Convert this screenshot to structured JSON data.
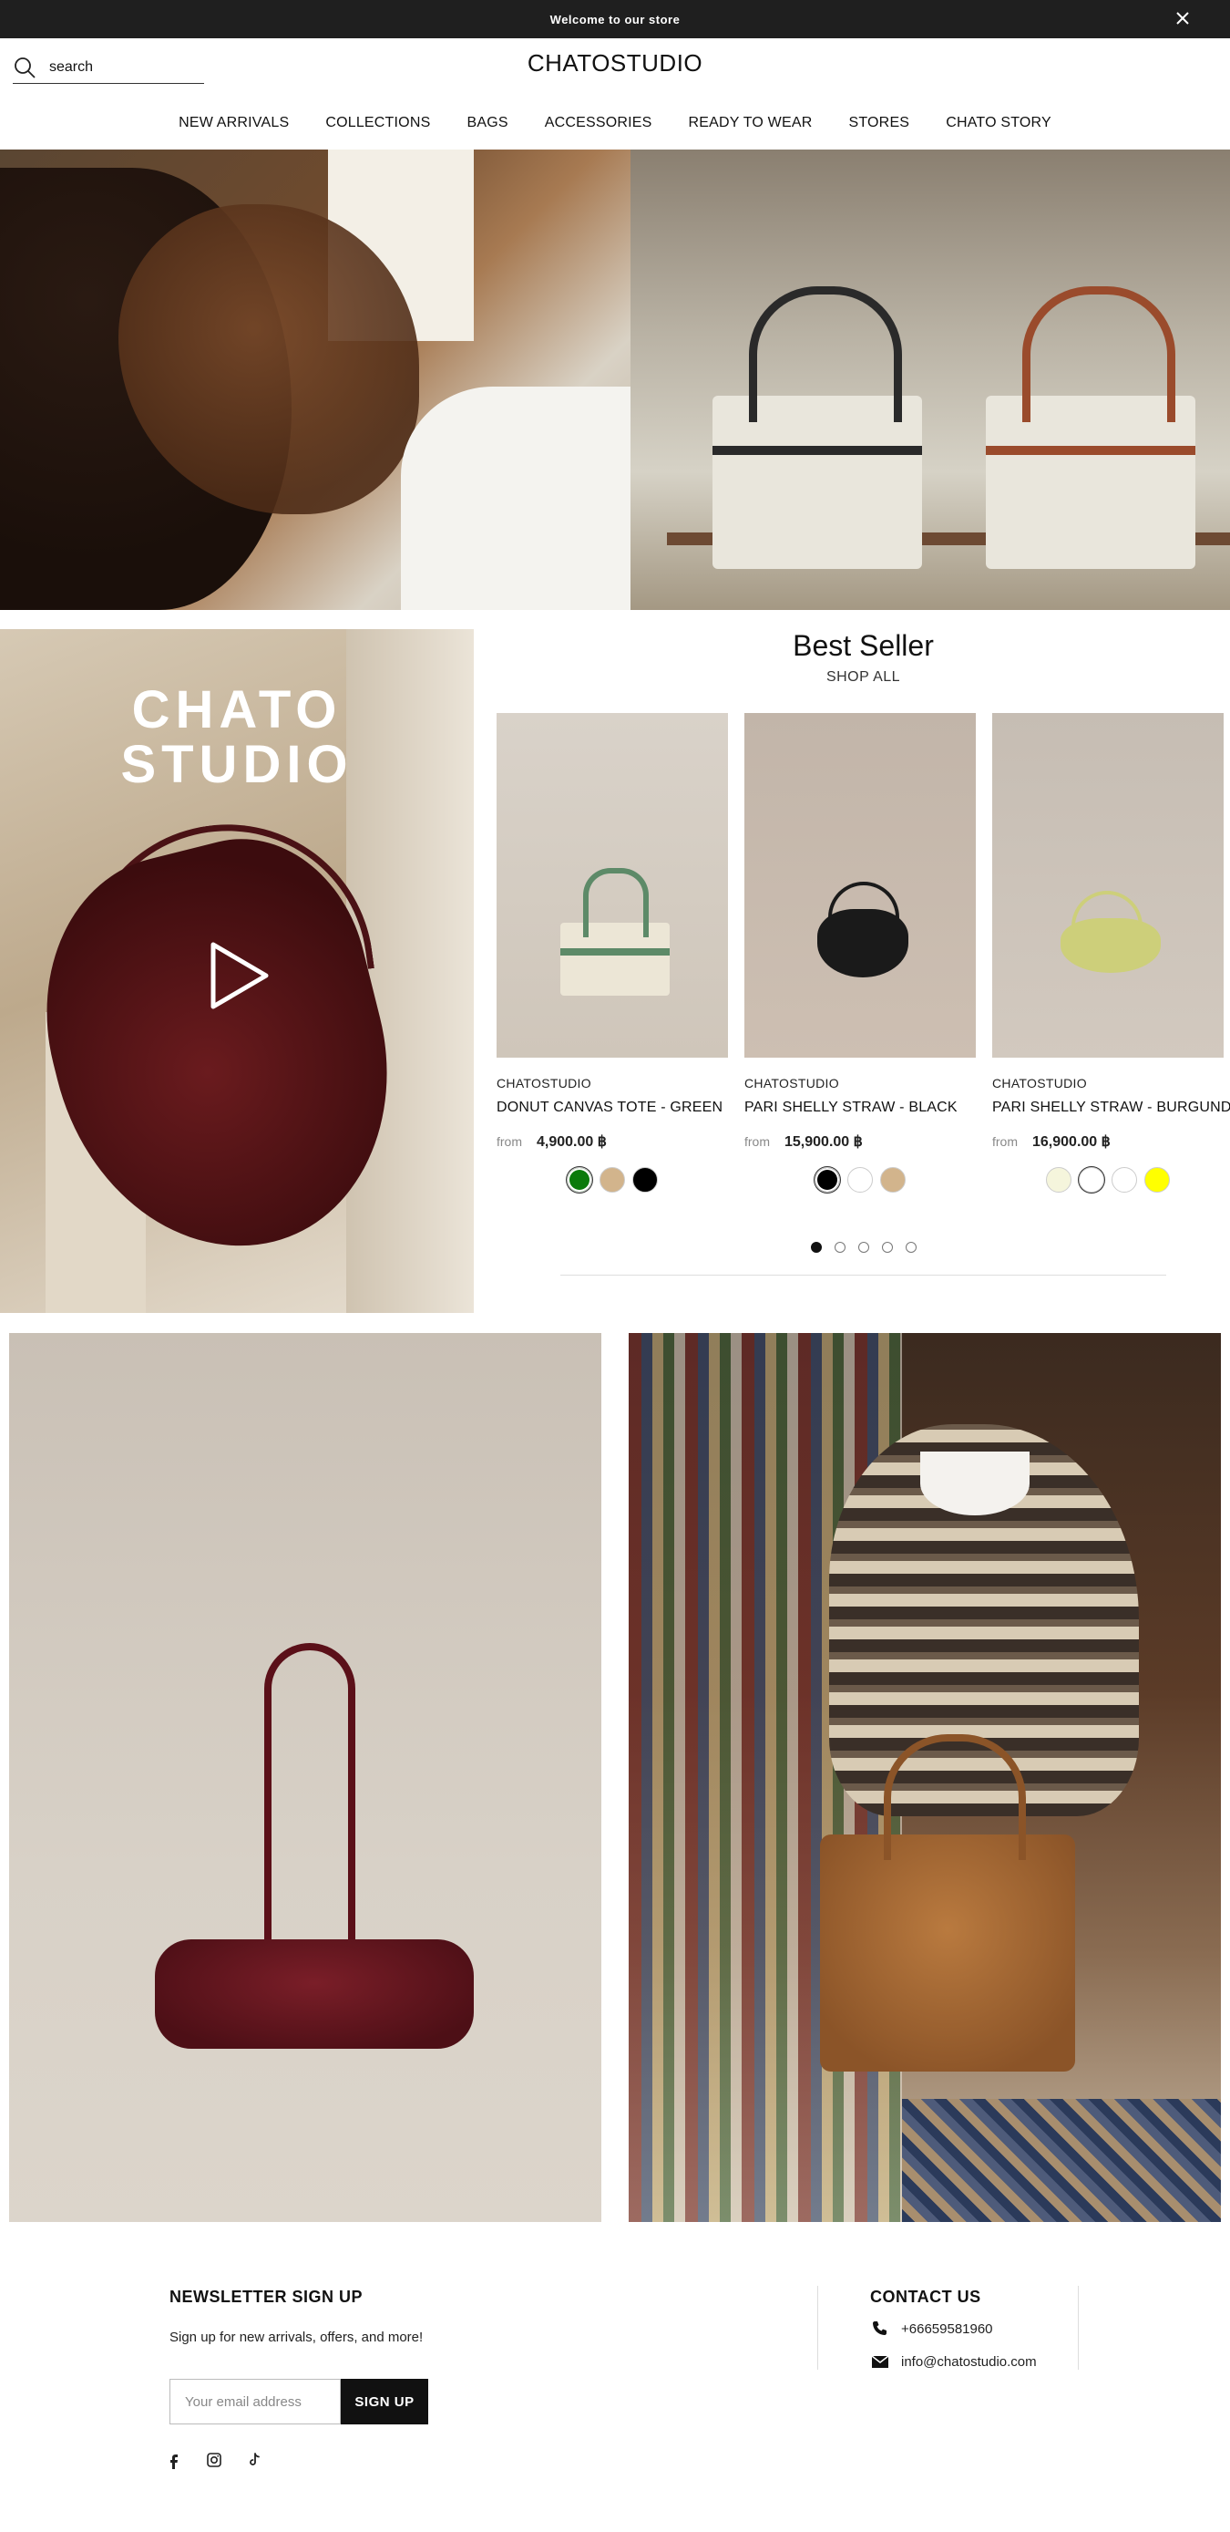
{
  "announcement": {
    "text": "Welcome to our store"
  },
  "header": {
    "search_placeholder": "search",
    "logo": "CHATOSTUDIO",
    "nav": [
      "NEW ARRIVALS",
      "COLLECTIONS",
      "BAGS",
      "ACCESSORIES",
      "READY TO WEAR",
      "STORES",
      "CHATO STORY"
    ]
  },
  "feature": {
    "video_words": [
      "CHATO",
      "STUDIO"
    ]
  },
  "best_seller": {
    "title": "Best Seller",
    "shop_all": "SHOP ALL",
    "products": [
      {
        "brand": "CHATOSTUDIO",
        "name": "DONUT CANVAS TOTE - GREEN",
        "from_label": "from",
        "price": "4,900.00 ฿",
        "swatches": [
          "#0b7a0b",
          "#d2b48c",
          "#000000"
        ],
        "selected_swatch": 0
      },
      {
        "brand": "CHATOSTUDIO",
        "name": "PARI SHELLY STRAW - BLACK",
        "from_label": "from",
        "price": "15,900.00 ฿",
        "swatches": [
          "#000000",
          "#ffffff",
          "#d2b48c"
        ],
        "selected_swatch": 0
      },
      {
        "brand": "CHATOSTUDIO",
        "name": "PARI SHELLY STRAW - BURGUNDY",
        "from_label": "from",
        "price": "16,900.00 ฿",
        "swatches": [
          "#f5f5dc",
          "#ffffff",
          "#ffffff",
          "#ffff00"
        ],
        "selected_swatch": 1
      }
    ],
    "pagination": {
      "pages": 5,
      "current": 1
    }
  },
  "footer": {
    "newsletter_title": "NEWSLETTER SIGN UP",
    "newsletter_text": "Sign up for new arrivals, offers, and more!",
    "email_placeholder": "Your email address",
    "signup_label": "SIGN UP",
    "social": [
      "facebook-icon",
      "instagram-icon",
      "tiktok-icon"
    ],
    "contact_title": "CONTACT US",
    "phone": "+66659581960",
    "email": "info@chatostudio.com"
  }
}
